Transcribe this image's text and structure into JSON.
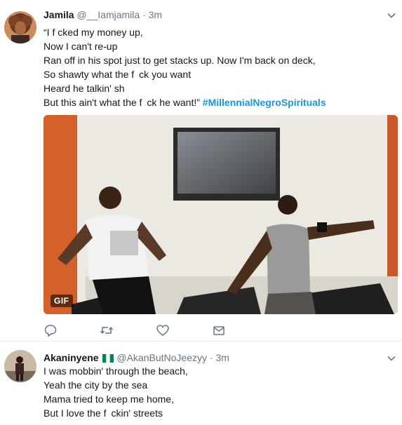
{
  "tweets": [
    {
      "name": "Jamila",
      "handle": "@__Iamjamila",
      "dot": "·",
      "time": "3m",
      "lines": [
        "“I f  cked my money up,",
        "Now I can't re-up",
        "Ran off in his spot just to get stacks up. Now I'm back on deck,",
        "So shawty what the f ck you want",
        "Heard he talkin' sh",
        "But this ain't what the f ck he want!”"
      ],
      "hashtag": "#MillennialNegroSpirituals",
      "media_badge": "GIF"
    },
    {
      "name": "Akaninyene",
      "handle": "@AkanButNoJeezyy",
      "dot": "·",
      "time": "3m",
      "lines": [
        "I was mobbin' through the beach,",
        "Yeah the city by the sea",
        "Mama tried to keep me home,",
        "But I love the f ckin' streets"
      ]
    }
  ],
  "icons": {
    "reply": "reply-icon",
    "retweet": "retweet-icon",
    "like": "heart-icon",
    "dm": "envelope-icon",
    "caret": "chevron-down-icon",
    "flag": "nigeria-flag-icon"
  },
  "colors": {
    "hashtag": "#1b95e0",
    "secondary": "#657786",
    "flag_green": "#008751"
  }
}
